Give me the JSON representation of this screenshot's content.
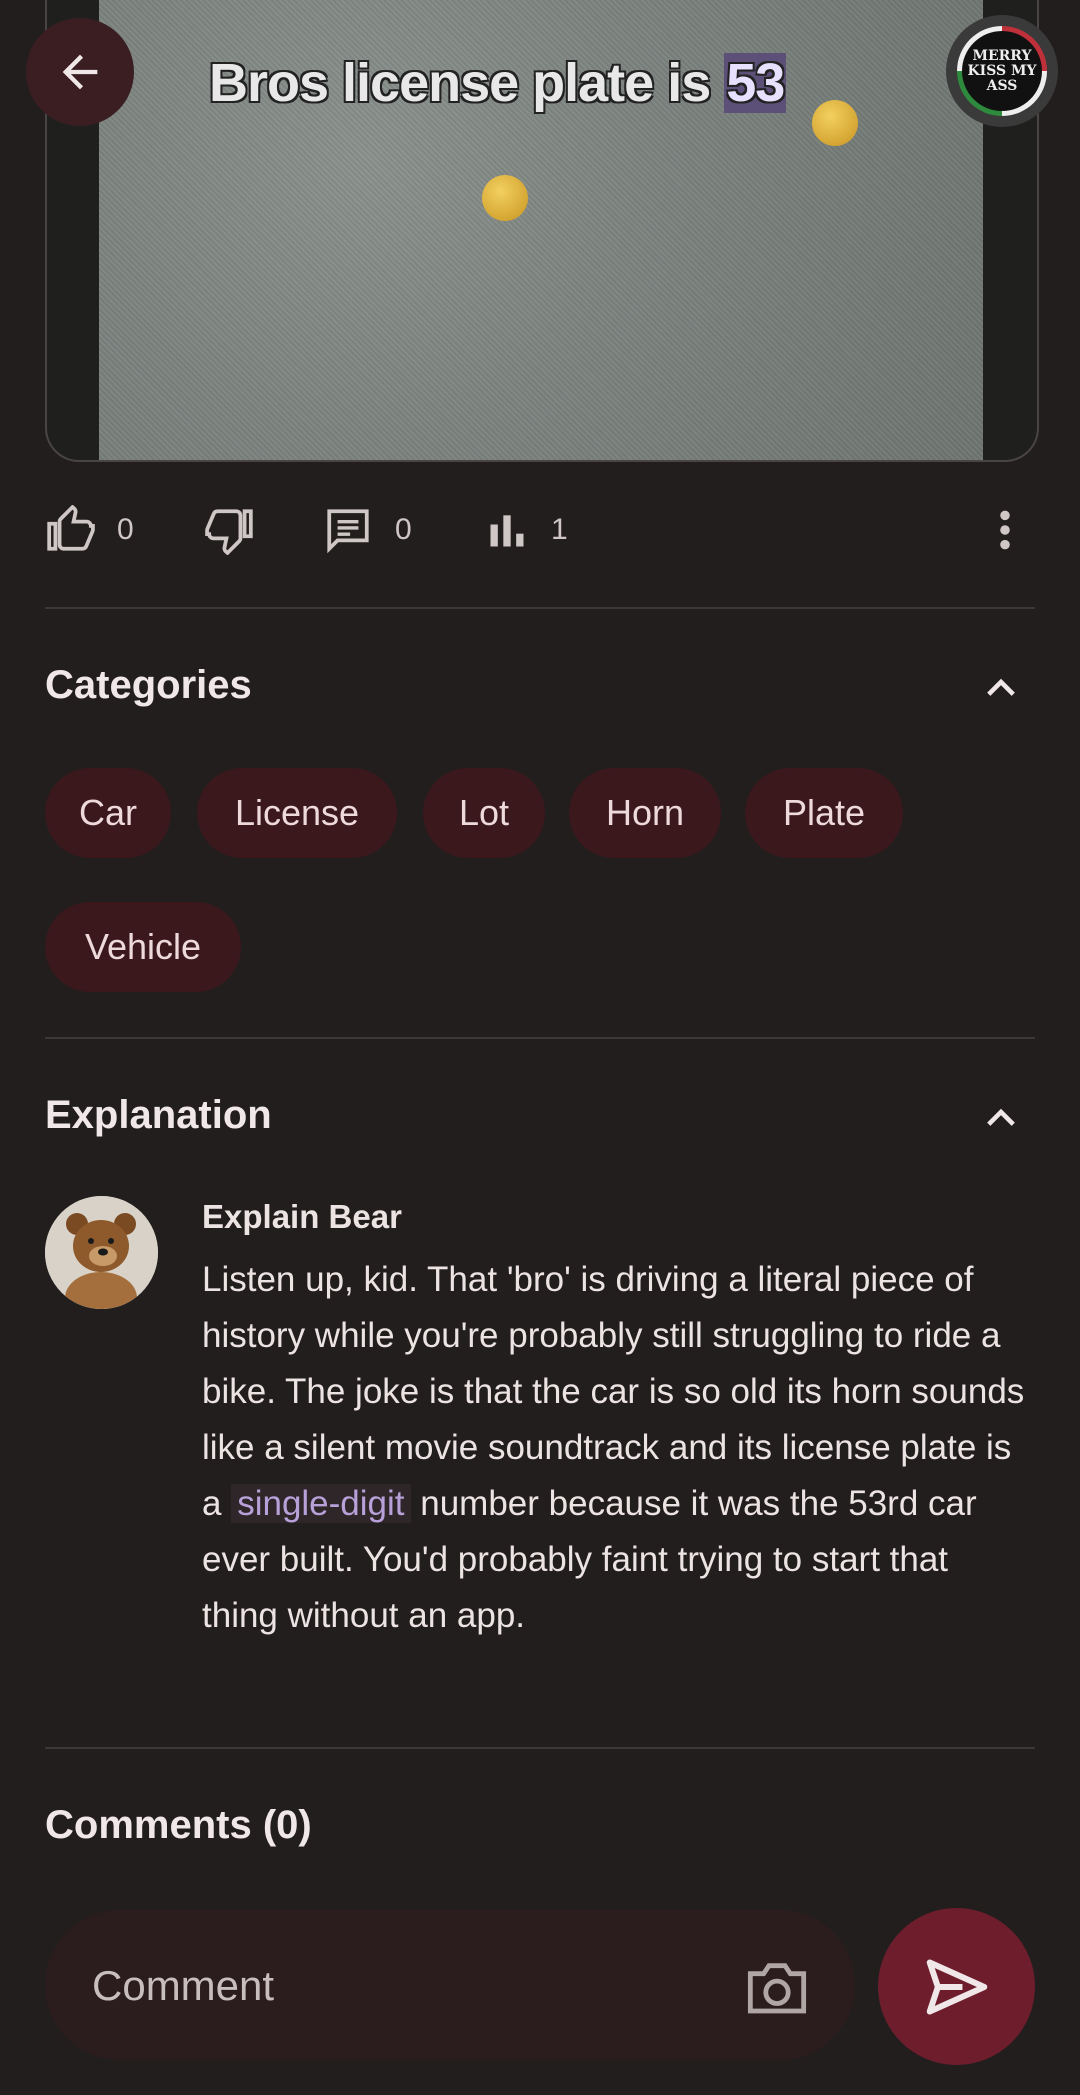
{
  "media": {
    "caption_prefix": "Bros license plate is ",
    "caption_highlight": "53",
    "avatar_text": [
      "MERRY",
      "KISS MY",
      "ASS"
    ]
  },
  "stats": {
    "likes": "0",
    "comments": "0",
    "views": "1"
  },
  "categories": {
    "title": "Categories",
    "chips": [
      "Car",
      "License",
      "Lot",
      "Horn",
      "Plate",
      "Vehicle"
    ]
  },
  "explanation": {
    "title": "Explanation",
    "author": "Explain Bear",
    "text_before": "Listen up, kid. That 'bro' is driving a literal piece of history while you're probably still struggling to ride a bike. The joke is that the car is so old its horn sounds like a silent movie soundtrack and its license plate is a ",
    "link": "single-digit",
    "text_after": " number because it was the 53rd car ever built. You'd probably faint trying to start that thing without an app."
  },
  "comments": {
    "title": "Comments (0)",
    "placeholder": "Comment"
  },
  "colors": {
    "background": "#231e1e",
    "chip": "#3a181c",
    "send": "#6e1d2d",
    "link": "#b8a0d8"
  }
}
